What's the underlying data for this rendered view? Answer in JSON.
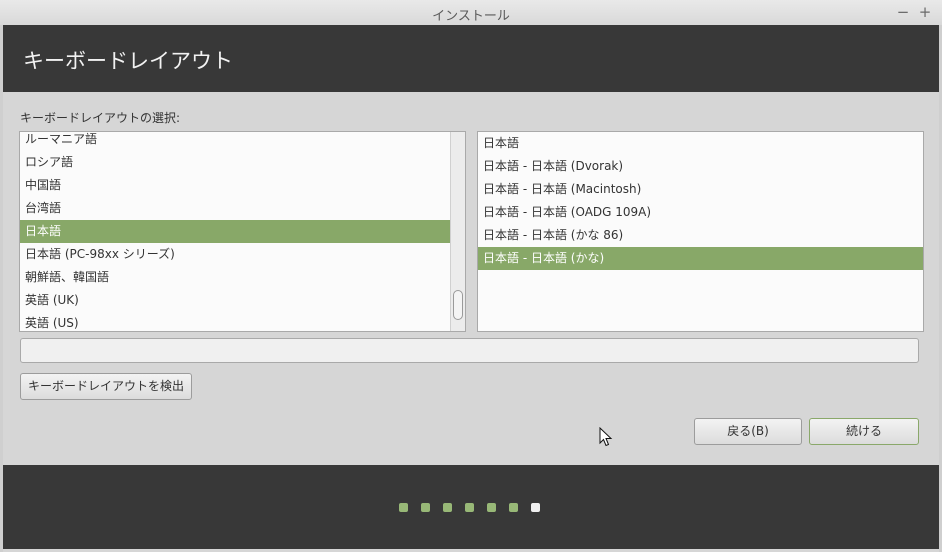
{
  "window": {
    "title": "インストール",
    "minimize_glyph": "−",
    "maximize_glyph": "+"
  },
  "header": {
    "title": "キーボードレイアウト"
  },
  "layout_section": {
    "label": "キーボードレイアウトの選択:"
  },
  "layouts": {
    "items": [
      "ルーマニア語",
      "ロシア語",
      "中国語",
      "台湾語",
      "日本語",
      "日本語 (PC-98xx シリーズ)",
      "朝鮮語、韓国語",
      "英語 (UK)",
      "英語 (US)"
    ],
    "selected_index": 4
  },
  "variants": {
    "items": [
      "日本語",
      "日本語 - 日本語 (Dvorak)",
      "日本語 - 日本語 (Macintosh)",
      "日本語 - 日本語 (OADG 109A)",
      "日本語 - 日本語 (かな 86)",
      "日本語 - 日本語 (かな)"
    ],
    "selected_index": 5
  },
  "test_input": {
    "value": "",
    "placeholder": ""
  },
  "buttons": {
    "detect": "キーボードレイアウトを検出",
    "back": "戻る(B)",
    "continue": "続ける"
  },
  "progress": {
    "total_steps": 7,
    "current_step": 7
  },
  "colors": {
    "accent": "#88a868",
    "header_bg": "#383838",
    "window_bg": "#d6d6d6",
    "dot_done": "#98b877",
    "dot_current": "#f0f0f0"
  },
  "icons": {
    "cursor": "mouse-pointer-icon"
  }
}
